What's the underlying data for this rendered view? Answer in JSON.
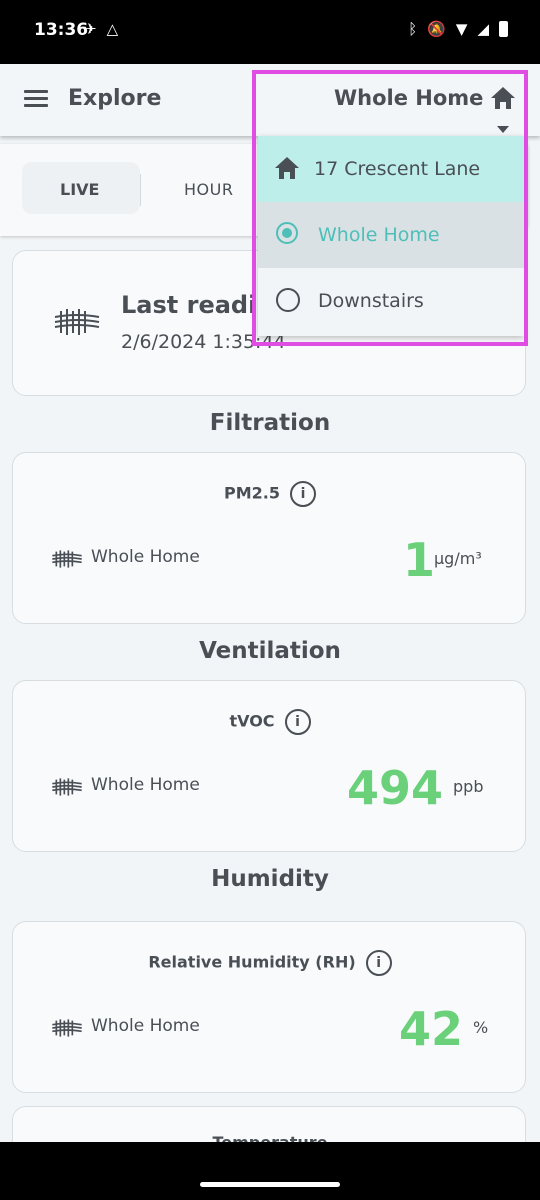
{
  "status_bar": {
    "time": "13:36",
    "left_icons": [
      "nfc-icon",
      "drive-icon"
    ],
    "right_icons": [
      "bluetooth-icon",
      "mute-icon",
      "wifi-icon",
      "signal-icon",
      "battery-icon"
    ]
  },
  "header": {
    "title": "Explore",
    "scope_label": "Whole Home"
  },
  "tabs": [
    {
      "label": "LIVE",
      "active": true
    },
    {
      "label": "HOUR",
      "active": false
    }
  ],
  "last_reading": {
    "label": "Last readi",
    "date": "2/6/2024 1:35:44"
  },
  "sections": {
    "filtration": "Filtration",
    "ventilation": "Ventilation",
    "humidity": "Humidity"
  },
  "metrics": {
    "pm25": {
      "name": "PM2.5",
      "location": "Whole Home",
      "value": "1",
      "unit": "µg/m³"
    },
    "tvoc": {
      "name": "tVOC",
      "location": "Whole Home",
      "value": "494",
      "unit": "ppb"
    },
    "rh": {
      "name": "Relative Humidity (RH)",
      "location": "Whole Home",
      "value": "42",
      "unit": "%"
    },
    "temp": {
      "name": "Temperature"
    }
  },
  "dropdown": {
    "group": "17 Crescent Lane",
    "options": [
      {
        "label": "Whole Home",
        "selected": true
      },
      {
        "label": "Downstairs",
        "selected": false
      }
    ]
  },
  "colors": {
    "accent": "#4ebfb8",
    "value_green": "#6ad07a",
    "highlight": "#e04de3",
    "text": "#4a4f55"
  }
}
